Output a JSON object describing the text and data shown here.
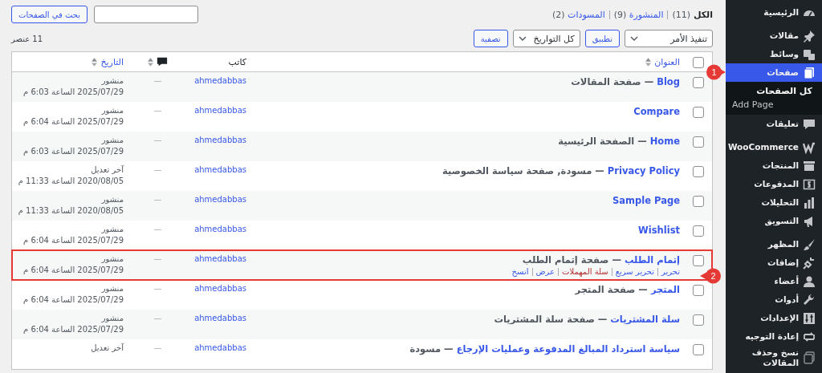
{
  "sidebar": {
    "groups": [
      [
        {
          "label": "الرئيسية",
          "selected": false
        }
      ],
      [
        {
          "label": "مقالات",
          "selected": false
        },
        {
          "label": "وسائط",
          "selected": false
        },
        {
          "label": "صفحات",
          "selected": true,
          "children": [
            {
              "label": "كل الصفحات",
              "selected": true
            },
            {
              "label": "Add Page",
              "selected": false
            }
          ]
        },
        {
          "label": "تعليقات",
          "selected": false
        }
      ],
      [
        {
          "label": "WooCommerce",
          "selected": false
        },
        {
          "label": "المنتجات",
          "selected": false
        },
        {
          "label": "المدفوعات",
          "selected": false
        },
        {
          "label": "التحليلات",
          "selected": false
        },
        {
          "label": "التسويق",
          "selected": false
        }
      ],
      [
        {
          "label": "المظهر",
          "selected": false
        },
        {
          "label": "إضافات",
          "selected": false
        },
        {
          "label": "أعضاء",
          "selected": false
        },
        {
          "label": "أدوات",
          "selected": false
        },
        {
          "label": "الإعدادات",
          "selected": false
        },
        {
          "label": "إعادة التوجيه",
          "selected": false
        },
        {
          "label": "نسخ وحذف المقالات",
          "selected": false
        }
      ]
    ]
  },
  "filters": [
    {
      "label": "الكل",
      "count": "(11)",
      "selected": true
    },
    {
      "label": "المنشورة",
      "count": "(9)",
      "selected": false
    },
    {
      "label": "المسودات",
      "count": "(2)",
      "selected": false
    }
  ],
  "search": {
    "button": "بحث في الصفحات"
  },
  "toolbar": {
    "bulk_action": "تنفيذ الأمر",
    "apply": "تطبيق",
    "dates": "كل التواريخ",
    "filter": "تصفية",
    "count": "11 عنصر"
  },
  "table": {
    "select_all": {
      "checked": false
    },
    "columns": [
      {
        "kind": "text",
        "label": "العنوان",
        "sortable": true
      },
      {
        "kind": "text",
        "label": "كاتب",
        "sortable": false
      },
      {
        "kind": "comments",
        "sortable": true
      },
      {
        "kind": "text",
        "label": "التاريخ",
        "sortable": true
      }
    ],
    "rows": [
      {
        "title": "Blog",
        "state": " — صفحة المقالات",
        "author": "ahmedabbas",
        "comments": "—",
        "status": "منشور",
        "date": "2025/07/29 الساعة 6:03 م",
        "checked": false,
        "highlighted": false
      },
      {
        "title": "Compare",
        "author": "ahmedabbas",
        "comments": "—",
        "status": "منشور",
        "date": "2025/07/29 الساعة 6:04 م",
        "checked": false,
        "highlighted": false
      },
      {
        "title": "Home",
        "state": " — الصفحة الرئيسية",
        "author": "ahmedabbas",
        "comments": "—",
        "status": "منشور",
        "date": "2025/07/29 الساعة 6:03 م",
        "checked": false,
        "highlighted": false
      },
      {
        "title": "Privacy Policy",
        "state": " — مسودة, صفحة سياسة الخصوصية",
        "author": "ahmedabbas",
        "comments": "—",
        "status": "آخر تعديل",
        "date": "2020/08/05 الساعة 11:33 م",
        "checked": false,
        "highlighted": false
      },
      {
        "title": "Sample Page",
        "author": "ahmedabbas",
        "comments": "—",
        "status": "منشور",
        "date": "2020/08/05 الساعة 11:33 م",
        "checked": false,
        "highlighted": false
      },
      {
        "title": "Wishlist",
        "author": "ahmedabbas",
        "comments": "—",
        "status": "منشور",
        "date": "2025/07/29 الساعة 6:04 م",
        "checked": false,
        "highlighted": false
      },
      {
        "title": "إتمام الطلب",
        "state": " — صفحة إتمام الطلب",
        "author": "ahmedabbas",
        "comments": "—",
        "status": "منشور",
        "date": "2025/07/29 الساعة 6:04 م",
        "checked": false,
        "highlighted": true,
        "actions": [
          {
            "label": "تحرير",
            "kind": "link"
          },
          {
            "label": "تحرير سريع",
            "kind": "link"
          },
          {
            "label": "سلة المهملات",
            "kind": "danger"
          },
          {
            "label": "عرض",
            "kind": "link"
          },
          {
            "label": "انسخ",
            "kind": "link"
          }
        ]
      },
      {
        "title": "المتجر",
        "state": " — صفحة المتجر",
        "author": "ahmedabbas",
        "comments": "—",
        "status": "منشور",
        "date": "2025/07/29 الساعة 6:04 م",
        "checked": false,
        "highlighted": false
      },
      {
        "title": "سلة المشتريات",
        "state": " — صفحة سلة المشتريات",
        "author": "ahmedabbas",
        "comments": "—",
        "status": "منشور",
        "date": "2025/07/29 الساعة 6:04 م",
        "checked": false,
        "highlighted": false
      },
      {
        "title": "سياسة استرداد المبالغ المدفوعة وعمليات الإرجاع",
        "state": " — مسودة",
        "author": "ahmedabbas",
        "comments": "—",
        "status": "آخر تعديل",
        "checked": false,
        "highlighted": false
      }
    ]
  },
  "callouts": [
    {
      "number": "1"
    },
    {
      "number": "2"
    }
  ]
}
